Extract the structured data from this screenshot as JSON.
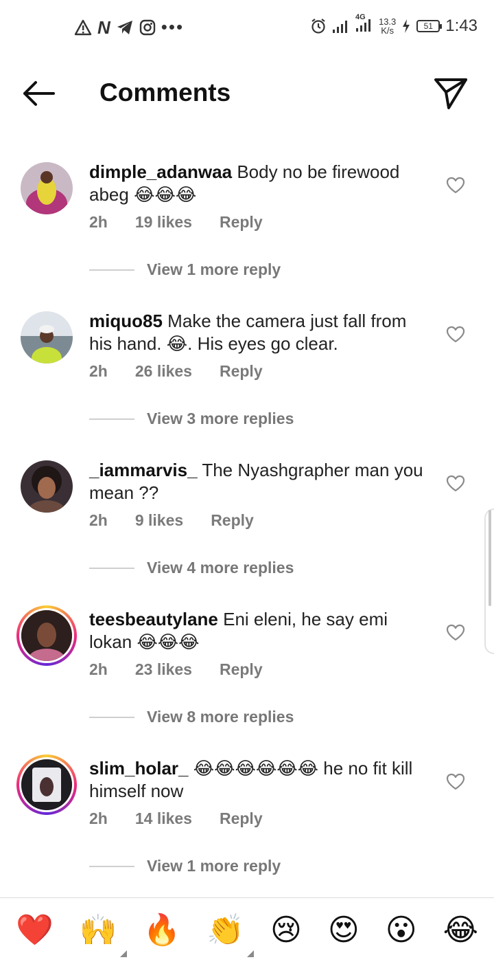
{
  "status_bar": {
    "left_icons": [
      "warning-icon",
      "n-app-icon",
      "telegram-icon",
      "instagram-icon",
      "more-dots-icon"
    ],
    "network_type": "4G",
    "speed_value": "13.3",
    "speed_unit": "K/s",
    "battery": "51",
    "time": "1:43"
  },
  "header": {
    "title": "Comments"
  },
  "comments": [
    {
      "username": "dimple_adanwaa",
      "text": "Body no be firewood abeg 😂😂😂",
      "time": "2h",
      "likes": "19 likes",
      "reply_label": "Reply",
      "view_replies": "View 1 more reply",
      "story_ring": false
    },
    {
      "username": "miquo85",
      "text": "Make the camera just fall from his hand. 😂. His eyes go clear.",
      "time": "2h",
      "likes": "26 likes",
      "reply_label": "Reply",
      "view_replies": "View 3 more replies",
      "story_ring": false
    },
    {
      "username": "_iammarvis_",
      "text": "The Nyashgrapher man you mean ??",
      "time": "2h",
      "likes": "9 likes",
      "reply_label": "Reply",
      "view_replies": "View 4 more replies",
      "story_ring": false
    },
    {
      "username": "teesbeautylane",
      "text": "Eni eleni, he say emi lokan 😂😂😂",
      "time": "2h",
      "likes": "23 likes",
      "reply_label": "Reply",
      "view_replies": "View 8 more replies",
      "story_ring": true
    },
    {
      "username": "slim_holar_",
      "text": "😂😂😂😂😂😂 he no fit kill himself now",
      "time": "2h",
      "likes": "14 likes",
      "reply_label": "Reply",
      "view_replies": "View 1 more reply",
      "story_ring": true
    }
  ],
  "emoji_bar": [
    "❤️",
    "🙌",
    "🔥",
    "👏",
    "😢",
    "😍",
    "😮",
    "😂"
  ],
  "colors": {
    "text_primary": "#111111",
    "text_secondary": "#777777",
    "divider": "#dbdbdb",
    "story_ring": [
      "#f9ce34",
      "#ee2a7b",
      "#6228d7"
    ]
  }
}
